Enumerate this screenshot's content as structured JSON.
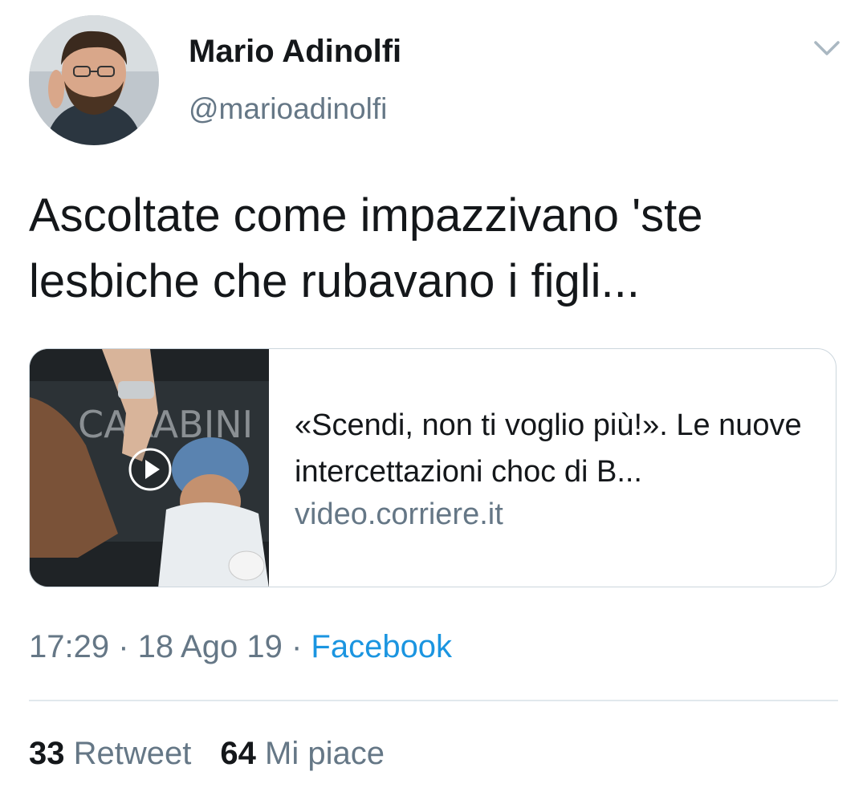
{
  "author": {
    "name": "Mario Adinolfi",
    "handle": "@marioadinolfi"
  },
  "tweet": {
    "text": "Ascoltate come impazzivano 'ste lesbiche che rubavano i figli..."
  },
  "card": {
    "title": "«Scendi, non ti voglio più!». Le nuove intercettazioni choc di B...",
    "domain": "video.corriere.it",
    "thumb_text": "CARABINI"
  },
  "meta": {
    "time": "17:29",
    "sep1": " · ",
    "date": "18 Ago 19",
    "sep2": " · ",
    "source": "Facebook"
  },
  "stats": {
    "retweets": "33",
    "retweets_label": "Retweet",
    "likes": "64",
    "likes_label": "Mi piace"
  },
  "colors": {
    "accent": "#1b95e0",
    "secondary_text": "#657786",
    "border": "#ccd6dd"
  },
  "icons": {
    "chevron": "chevron-down-icon",
    "play": "play-icon"
  }
}
